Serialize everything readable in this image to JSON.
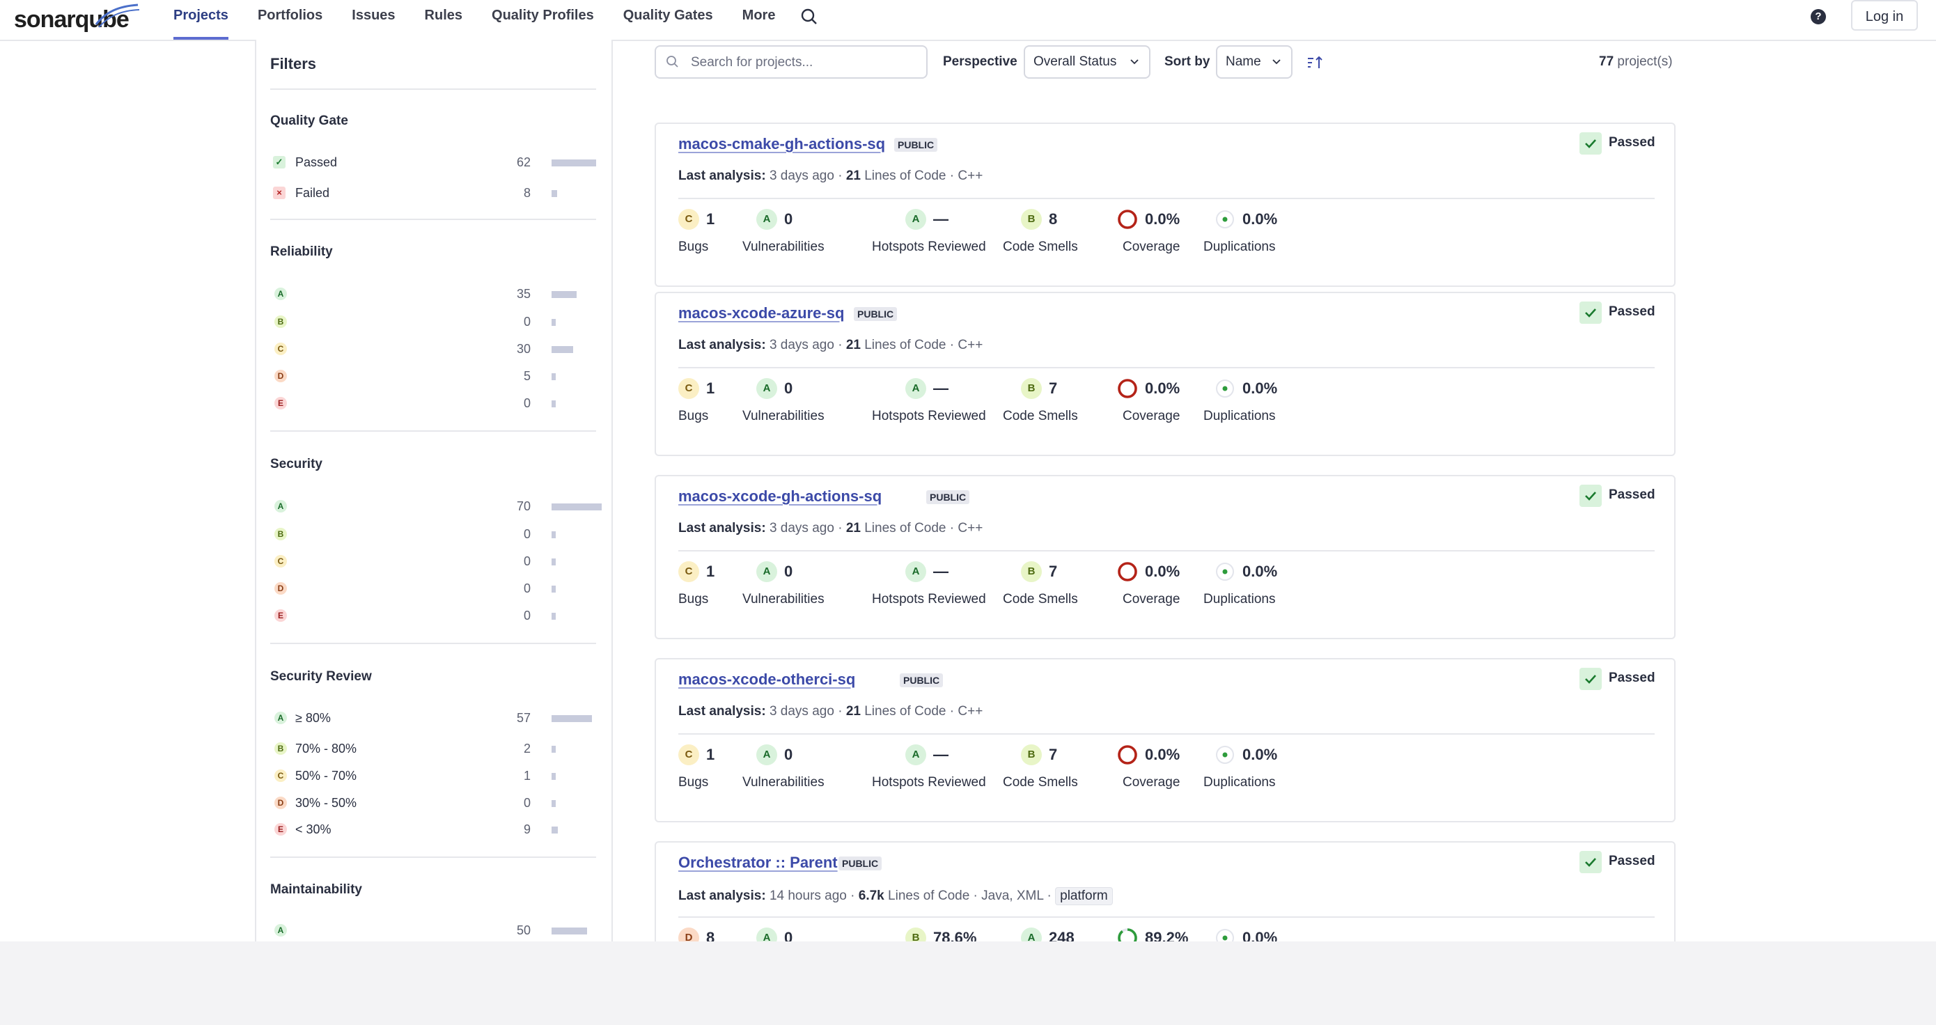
{
  "nav": {
    "logo": "sonarqube",
    "items": [
      "Projects",
      "Portfolios",
      "Issues",
      "Rules",
      "Quality Profiles",
      "Quality Gates",
      "More"
    ],
    "active": "Projects",
    "login": "Log in"
  },
  "filters": {
    "title": "Filters",
    "quality_gate": {
      "title": "Quality Gate",
      "rows": [
        {
          "label": "Passed",
          "count": "62",
          "fraction": 0.886
        },
        {
          "label": "Failed",
          "count": "8",
          "fraction": 0.114
        }
      ]
    },
    "reliability": {
      "title": "Reliability",
      "rows": [
        {
          "grade": "A",
          "count": "35",
          "fraction": 0.5
        },
        {
          "grade": "B",
          "count": "0",
          "fraction": 0
        },
        {
          "grade": "C",
          "count": "30",
          "fraction": 0.43
        },
        {
          "grade": "D",
          "count": "5",
          "fraction": 0.07
        },
        {
          "grade": "E",
          "count": "0",
          "fraction": 0
        }
      ]
    },
    "security": {
      "title": "Security",
      "rows": [
        {
          "grade": "A",
          "count": "70",
          "fraction": 1
        },
        {
          "grade": "B",
          "count": "0",
          "fraction": 0
        },
        {
          "grade": "C",
          "count": "0",
          "fraction": 0
        },
        {
          "grade": "D",
          "count": "0",
          "fraction": 0
        },
        {
          "grade": "E",
          "count": "0",
          "fraction": 0
        }
      ]
    },
    "security_review": {
      "title": "Security Review",
      "rows": [
        {
          "grade": "A",
          "label": "≥ 80%",
          "count": "57",
          "fraction": 0.81
        },
        {
          "grade": "B",
          "label": "70% - 80%",
          "count": "2",
          "fraction": 0.03
        },
        {
          "grade": "C",
          "label": "50% - 70%",
          "count": "1",
          "fraction": 0.015
        },
        {
          "grade": "D",
          "label": "30% - 50%",
          "count": "0",
          "fraction": 0
        },
        {
          "grade": "E",
          "label": "< 30%",
          "count": "9",
          "fraction": 0.13
        }
      ]
    },
    "maintainability": {
      "title": "Maintainability",
      "rows": [
        {
          "grade": "A",
          "count": "50",
          "fraction": 0.71
        }
      ]
    }
  },
  "toolbar": {
    "search_placeholder": "Search for projects...",
    "perspective_label": "Perspective",
    "perspective_value": "Overall Status",
    "sort_label": "Sort by",
    "sort_value": "Name",
    "count_number": "77",
    "count_suffix": "project(s)"
  },
  "projects": [
    {
      "name": "macos-cmake-gh-actions-sq",
      "visibility": "PUBLIC",
      "gate": "Passed",
      "last_label": "Last analysis:",
      "last_value": "3 days ago",
      "loc": "21",
      "loc_label": "Lines of Code",
      "languages": "C++",
      "tag": "",
      "bugs_grade": "C",
      "bugs": "1",
      "vuln_grade": "A",
      "vulns": "0",
      "hotspot_grade": "A",
      "hotspots": "—",
      "smells_grade": "B",
      "smells": "8",
      "coverage": "0.0%",
      "coverage_fraction": 0,
      "duplications": "0.0%"
    },
    {
      "name": "macos-xcode-azure-sq",
      "visibility": "PUBLIC",
      "gate": "Passed",
      "last_label": "Last analysis:",
      "last_value": "3 days ago",
      "loc": "21",
      "loc_label": "Lines of Code",
      "languages": "C++",
      "tag": "",
      "bugs_grade": "C",
      "bugs": "1",
      "vuln_grade": "A",
      "vulns": "0",
      "hotspot_grade": "A",
      "hotspots": "—",
      "smells_grade": "B",
      "smells": "7",
      "coverage": "0.0%",
      "coverage_fraction": 0,
      "duplications": "0.0%"
    },
    {
      "name": "macos-xcode-gh-actions-sq",
      "visibility": "PUBLIC",
      "gate": "Passed",
      "last_label": "Last analysis:",
      "last_value": "3 days ago",
      "loc": "21",
      "loc_label": "Lines of Code",
      "languages": "C++",
      "tag": "",
      "bugs_grade": "C",
      "bugs": "1",
      "vuln_grade": "A",
      "vulns": "0",
      "hotspot_grade": "A",
      "hotspots": "—",
      "smells_grade": "B",
      "smells": "7",
      "coverage": "0.0%",
      "coverage_fraction": 0,
      "duplications": "0.0%"
    },
    {
      "name": "macos-xcode-otherci-sq",
      "visibility": "PUBLIC",
      "gate": "Passed",
      "last_label": "Last analysis:",
      "last_value": "3 days ago",
      "loc": "21",
      "loc_label": "Lines of Code",
      "languages": "C++",
      "tag": "",
      "bugs_grade": "C",
      "bugs": "1",
      "vuln_grade": "A",
      "vulns": "0",
      "hotspot_grade": "A",
      "hotspots": "—",
      "smells_grade": "B",
      "smells": "7",
      "coverage": "0.0%",
      "coverage_fraction": 0,
      "duplications": "0.0%"
    },
    {
      "name": "Orchestrator :: Parent",
      "visibility": "PUBLIC",
      "gate": "Passed",
      "last_label": "Last analysis:",
      "last_value": "14 hours ago",
      "loc": "6.7k",
      "loc_label": "Lines of Code",
      "languages": "Java, XML",
      "tag": "platform",
      "bugs_grade": "D",
      "bugs": "8",
      "vuln_grade": "A",
      "vulns": "0",
      "hotspot_grade": "B",
      "hotspots": "78.6%",
      "smells_grade": "A",
      "smells": "248",
      "coverage": "89.2%",
      "coverage_fraction": 0.892,
      "duplications": "0.0%"
    }
  ],
  "metric_labels": {
    "bugs": "Bugs",
    "vulns": "Vulnerabilities",
    "hotspots": "Hotspots Reviewed",
    "smells": "Code Smells",
    "coverage": "Coverage",
    "duplications": "Duplications"
  },
  "colors": {
    "accent": "#5d6cd0",
    "link": "#3c4aa8",
    "passed": "#1a7a2e",
    "coverage_ring": "#b42318",
    "coverage_good": "#2e9c3c"
  },
  "icons": {
    "search": "search-icon",
    "help": "help-icon",
    "sort": "sort-ascending-icon",
    "chevron": "chevron-down-icon",
    "check": "check-icon"
  }
}
